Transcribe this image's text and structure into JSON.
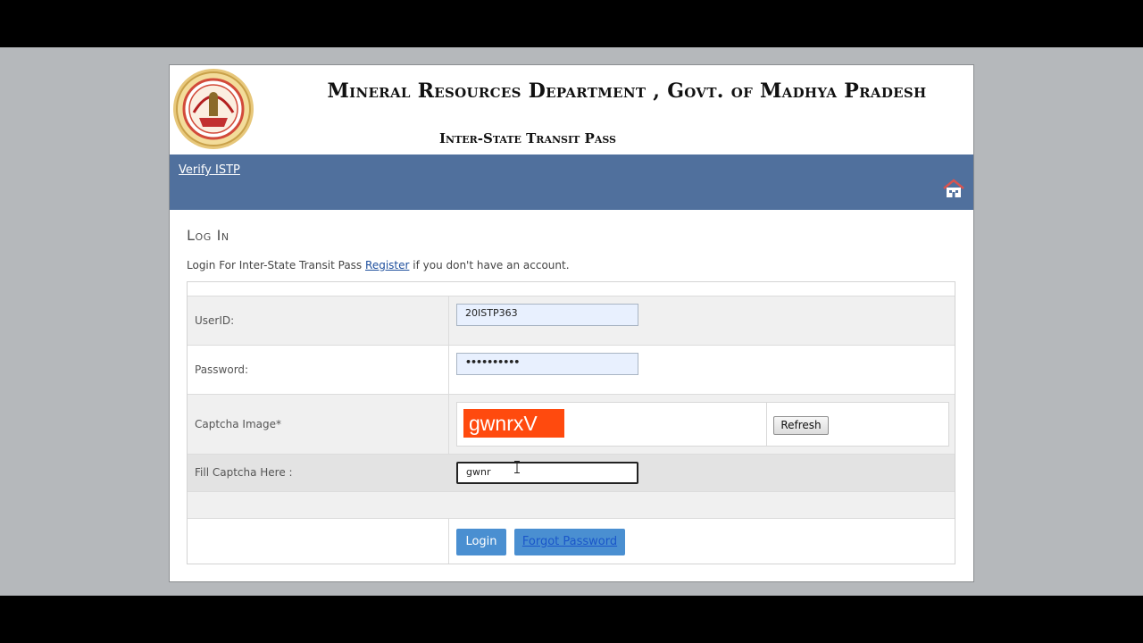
{
  "header": {
    "department_title": "Mineral Resources Department , Govt. of Madhya Pradesh",
    "subtitle": "Inter-State Transit Pass",
    "emblem_icon": "mp-state-emblem-icon"
  },
  "navbar": {
    "link_label": "Verify ISTP",
    "home_icon": "home-icon",
    "bg_color": "#50709d"
  },
  "login": {
    "heading": "Log In",
    "intro_before": "Login For Inter-State Transit Pass",
    "register_link": "Register",
    "intro_after": "if you don't have an account."
  },
  "form": {
    "userid_label": "UserID:",
    "userid_value": "20ISTP363",
    "password_label": "Password:",
    "password_value": "••••••••••",
    "captcha_label": "Captcha Image*",
    "captcha_text": "gwnrxV",
    "refresh_label": "Refresh",
    "fill_captcha_label": "Fill Captcha Here :",
    "fill_captcha_value": "gwnr",
    "login_button": "Login",
    "forgot_password": "Forgot Password"
  },
  "colors": {
    "captcha_bg": "#ff4a0e",
    "button_blue": "#4a8fd1"
  }
}
